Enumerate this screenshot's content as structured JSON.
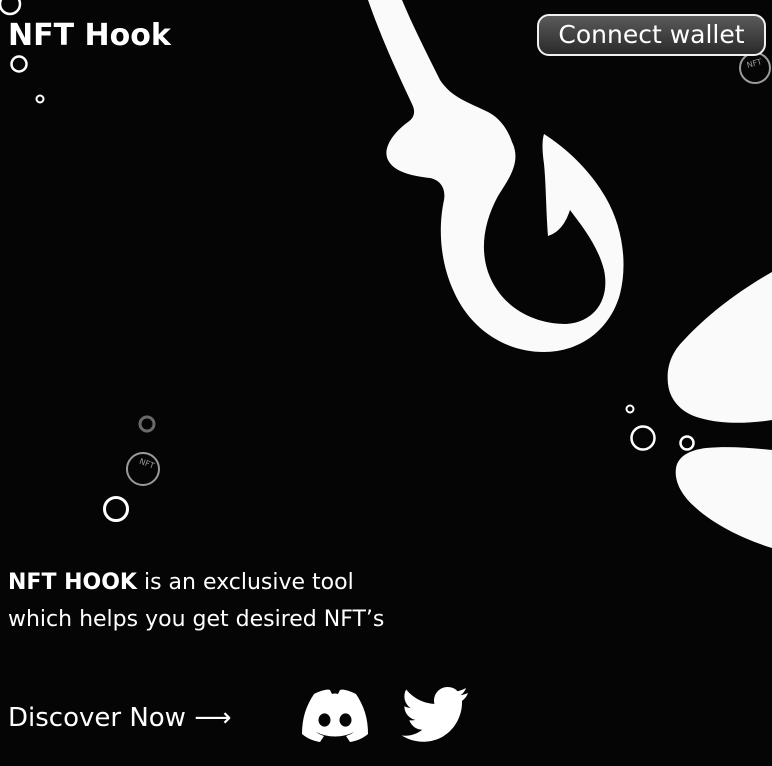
{
  "header": {
    "logo": "NFT Hook",
    "connect_label": "Connect wallet"
  },
  "hero": {
    "brand_bold": "NFT HOOK",
    "tagline_rest": " is an exclusive tool which helps you get desired NFT’s",
    "discover_label": "Discover Now ⟶"
  },
  "badges": {
    "nft_text": "NFT"
  },
  "social": {
    "discord_icon": "discord-icon",
    "twitter_icon": "twitter-icon"
  },
  "colors": {
    "background": "#050505",
    "foreground": "#ffffff"
  }
}
